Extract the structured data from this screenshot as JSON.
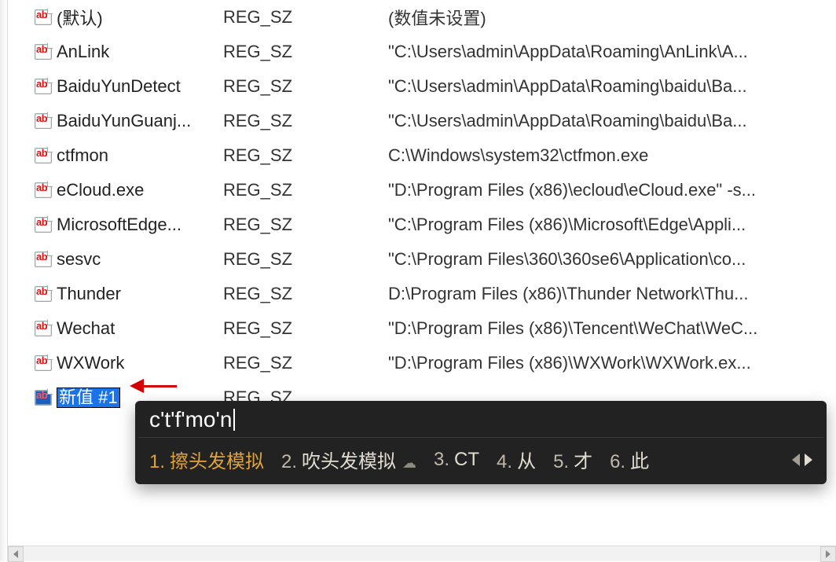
{
  "registry": {
    "rows": [
      {
        "name": "(默认)",
        "type": "REG_SZ",
        "data": "(数值未设置)"
      },
      {
        "name": "AnLink",
        "type": "REG_SZ",
        "data": "\"C:\\Users\\admin\\AppData\\Roaming\\AnLink\\A..."
      },
      {
        "name": "BaiduYunDetect",
        "type": "REG_SZ",
        "data": "\"C:\\Users\\admin\\AppData\\Roaming\\baidu\\Ba..."
      },
      {
        "name": "BaiduYunGuanj...",
        "type": "REG_SZ",
        "data": "\"C:\\Users\\admin\\AppData\\Roaming\\baidu\\Ba..."
      },
      {
        "name": "ctfmon",
        "type": "REG_SZ",
        "data": "C:\\Windows\\system32\\ctfmon.exe"
      },
      {
        "name": "eCloud.exe",
        "type": "REG_SZ",
        "data": "\"D:\\Program Files (x86)\\ecloud\\eCloud.exe\" -s..."
      },
      {
        "name": "MicrosoftEdge...",
        "type": "REG_SZ",
        "data": "\"C:\\Program Files (x86)\\Microsoft\\Edge\\Appli..."
      },
      {
        "name": "sesvc",
        "type": "REG_SZ",
        "data": "\"C:\\Program Files\\360\\360se6\\Application\\co..."
      },
      {
        "name": "Thunder",
        "type": "REG_SZ",
        "data": "D:\\Program Files (x86)\\Thunder Network\\Thu..."
      },
      {
        "name": "Wechat",
        "type": "REG_SZ",
        "data": "\"D:\\Program Files (x86)\\Tencent\\WeChat\\WeC..."
      },
      {
        "name": "WXWork",
        "type": "REG_SZ",
        "data": "\"D:\\Program Files (x86)\\WXWork\\WXWork.ex..."
      }
    ],
    "new_value": {
      "name": "新值 #1",
      "type": "REG_SZ",
      "data": ""
    }
  },
  "ime": {
    "input": "c't'f'mo'n",
    "candidates": [
      {
        "n": "1.",
        "t": "擦头发模拟"
      },
      {
        "n": "2.",
        "t": "吹头发模拟"
      },
      {
        "n": "3.",
        "t": "CT"
      },
      {
        "n": "4.",
        "t": "从"
      },
      {
        "n": "5.",
        "t": "才"
      },
      {
        "n": "6.",
        "t": "此"
      }
    ]
  }
}
